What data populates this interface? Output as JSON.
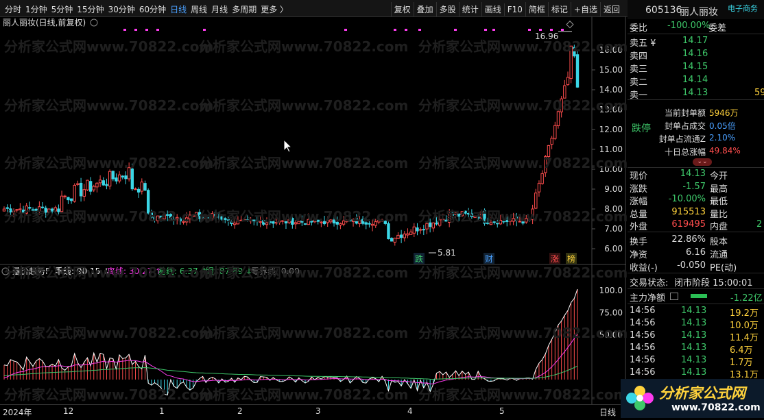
{
  "toolbar": {
    "periods": [
      "分时",
      "1分钟",
      "5分钟",
      "15分钟",
      "30分钟",
      "60分钟",
      "日线",
      "周线",
      "月线",
      "多周期",
      "更多 〉"
    ],
    "active_period": "日线",
    "tools": [
      "复权",
      "叠加",
      "多股",
      "统计",
      "画线",
      "F10",
      "简框",
      "标记",
      "+自选",
      "返回"
    ]
  },
  "stock": {
    "code": "605136",
    "name": "丽人丽妆",
    "industry": "电子商务"
  },
  "main_chart": {
    "title": "丽人丽妆(日线,前复权)",
    "price_labels": [
      "16.00",
      "15.00",
      "14.00",
      "13.00",
      "12.00",
      "11.00",
      "10.00",
      "9.00",
      "8.00",
      "7.00",
      "6.00"
    ],
    "high_label": "16.96",
    "low_label": "5.81",
    "markers": [
      "跌",
      "财",
      "涨",
      "榜"
    ]
  },
  "indicator": {
    "name": "量价趋势F",
    "items": [
      {
        "label": "乖线:",
        "value": "90.15",
        "arrow": "↓"
      },
      {
        "label": "离线:",
        "value": "30.27",
        "arrow": "↑"
      },
      {
        "label": "基线:",
        "value": "6.37",
        "arrow": "↑"
      },
      {
        "label": "眼:",
        "value": "87.89",
        "arrow": "↓"
      },
      {
        "label": "零界线:",
        "value": "0.00",
        "arrow": ""
      }
    ],
    "scale": [
      "100.0",
      "75.00",
      "50.00"
    ]
  },
  "xaxis": {
    "labels": [
      "2024年",
      "12",
      "1",
      "2",
      "3",
      "4",
      "5"
    ],
    "period_label": "日线"
  },
  "order_book": {
    "weibi_label": "委比",
    "weibi": "-100.00%",
    "weicha_label": "委差",
    "asks": [
      {
        "label": "卖五 ¥",
        "price": "14.17",
        "vol": ""
      },
      {
        "label": "卖四",
        "price": "14.16",
        "vol": ""
      },
      {
        "label": "卖三",
        "price": "14.15",
        "vol": ""
      },
      {
        "label": "卖二",
        "price": "14.14",
        "vol": ""
      },
      {
        "label": "卖一",
        "price": "14.13",
        "vol": "59"
      }
    ]
  },
  "limit": {
    "status": "跌停",
    "rows": [
      {
        "label": "当前封单额",
        "value": "5946万"
      },
      {
        "label": "封单占成交",
        "value": "0.05倍"
      },
      {
        "label": "封单占流通Z",
        "value": "2.10%"
      },
      {
        "label": "十日总涨幅",
        "value": "49.84%"
      }
    ]
  },
  "quote": {
    "rows": [
      {
        "l1": "现价",
        "v1": "14.13",
        "l2": "今开",
        "v2": ""
      },
      {
        "l1": "涨跌",
        "v1": "-1.57",
        "l2": "最高",
        "v2": ""
      },
      {
        "l1": "涨幅",
        "v1": "-10.00%",
        "l2": "最低",
        "v2": ""
      },
      {
        "l1": "总量",
        "v1": "915513",
        "l2": "量比",
        "v2": ""
      },
      {
        "l1": "外盘",
        "v1": "619495",
        "l2": "内盘",
        "v2": "2"
      }
    ],
    "rows2": [
      {
        "l1": "换手",
        "v1": "22.86%",
        "l2": "股本",
        "v2": ""
      },
      {
        "l1": "净资",
        "v1": "6.16",
        "l2": "流通",
        "v2": ""
      },
      {
        "l1": "收益(-)",
        "v1": "-0.050",
        "l2": "PE(动)",
        "v2": ""
      }
    ]
  },
  "trade_status": {
    "label": "交易状态:",
    "value": "闭市阶段 15:00:01"
  },
  "main_flow": {
    "label": "主力净额",
    "value": "-1.22亿"
  },
  "ticks": [
    {
      "time": "14:56",
      "price": "14.13",
      "vol": "19.2万"
    },
    {
      "time": "14:56",
      "price": "14.13",
      "vol": "10.0万"
    },
    {
      "time": "14:56",
      "price": "14.13",
      "vol": "11.4万"
    },
    {
      "time": "14:56",
      "price": "14.13",
      "vol": "6.4万"
    },
    {
      "time": "14:56",
      "price": "14.13",
      "vol": "1.7万"
    },
    {
      "time": "14:56",
      "price": "14.13",
      "vol": "13.1万"
    }
  ],
  "watermark": "分析家公式网www.70822.com",
  "logo": {
    "text": "分析家公式网",
    "url": "www.70822.com"
  },
  "colors": {
    "up": "#ff4d4d",
    "down": "#3bd6e6",
    "green": "#3ec86a",
    "magenta": "#ff3cf0",
    "yellow": "#ffd23c"
  }
}
